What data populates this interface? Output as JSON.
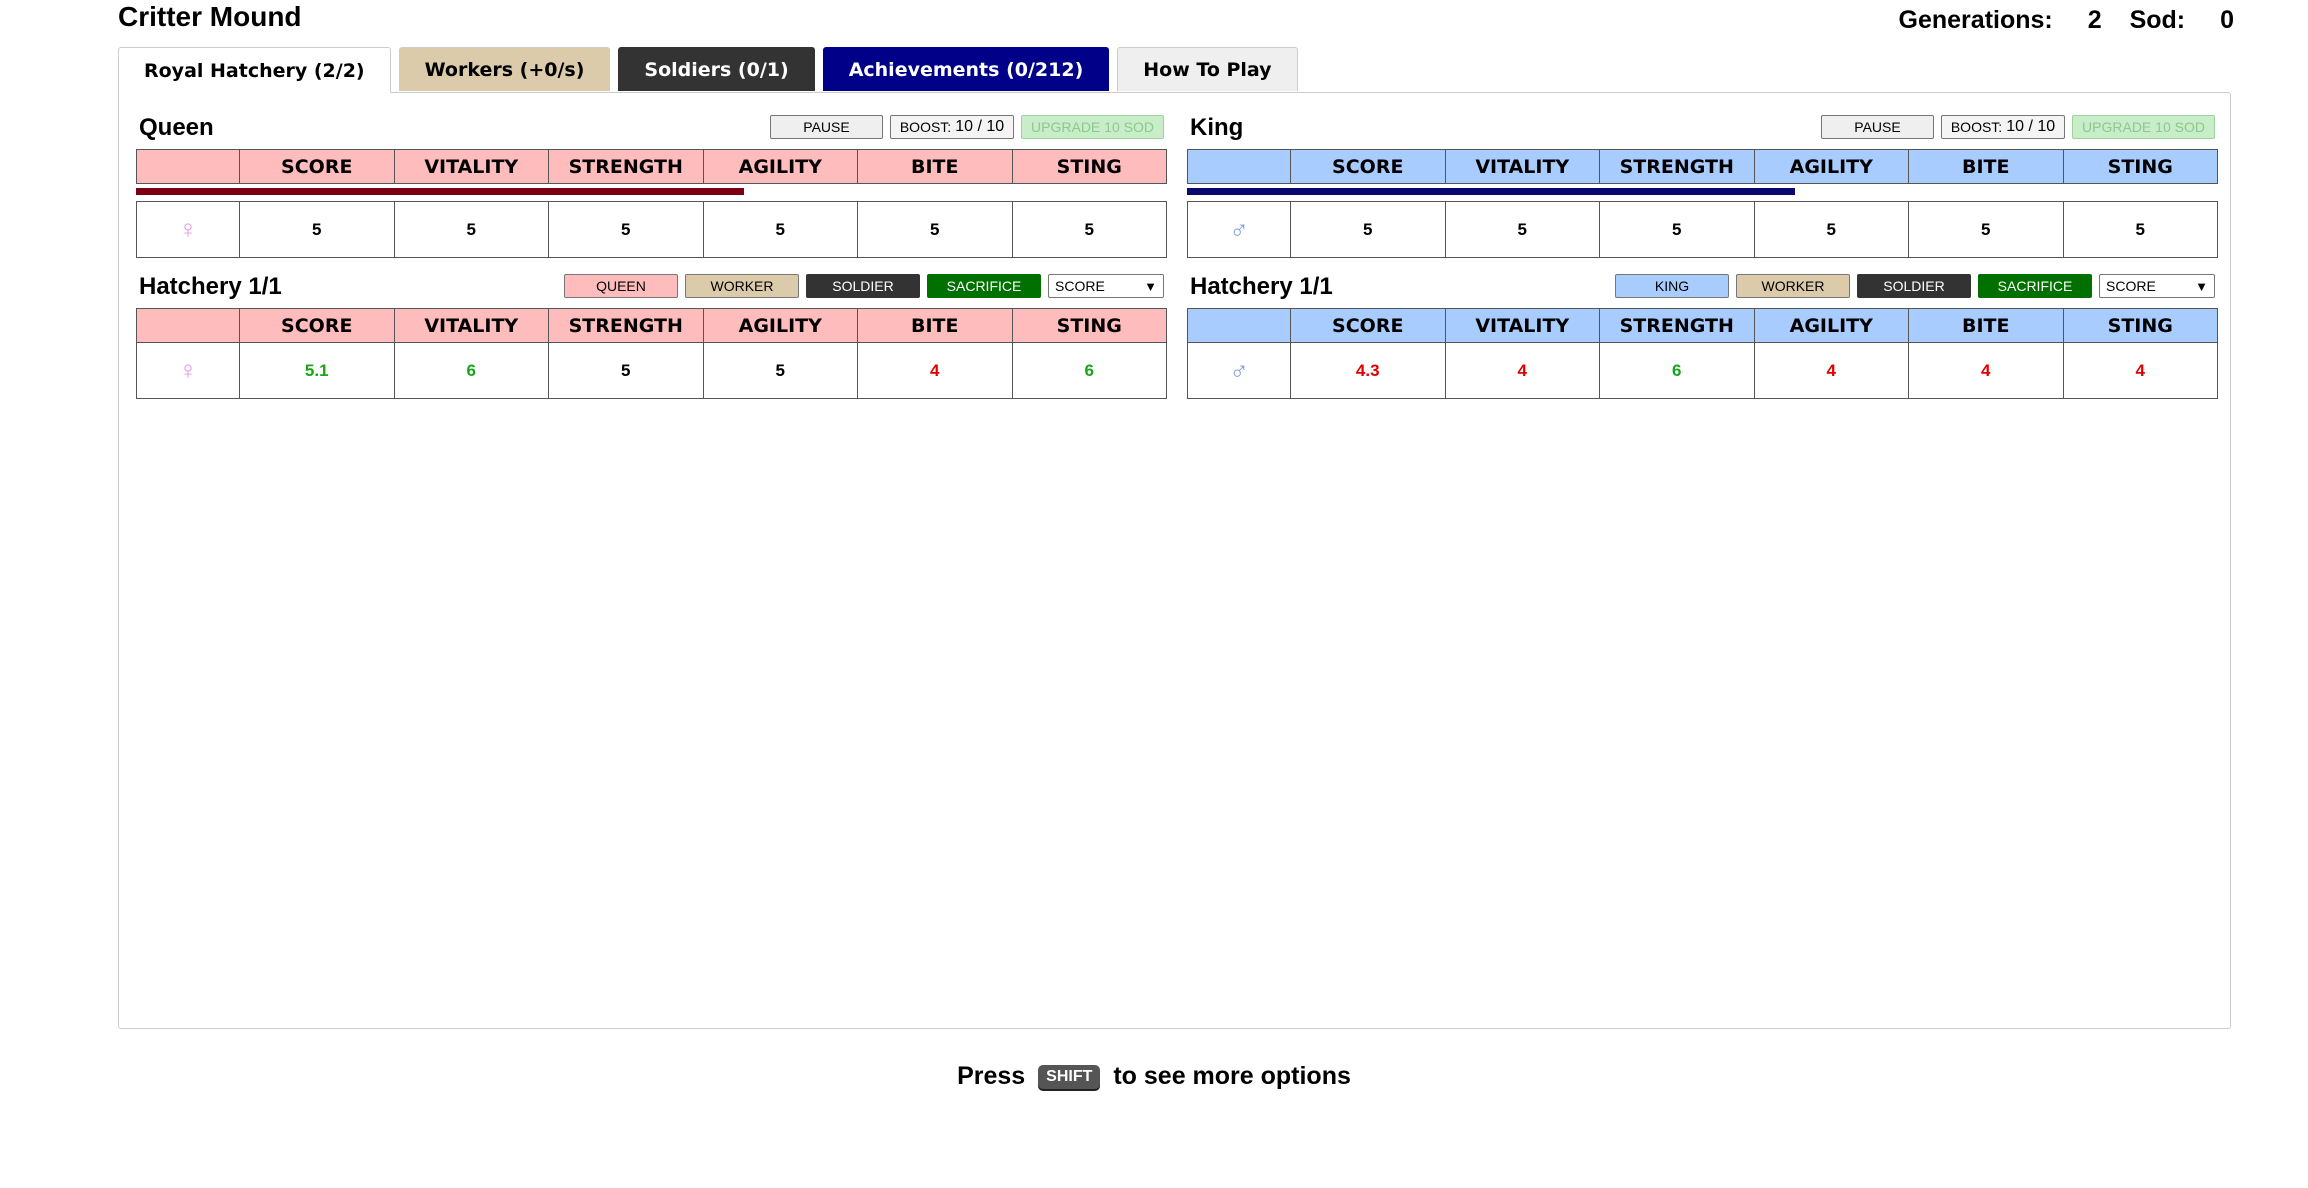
{
  "app_title": "Critter Mound",
  "header": {
    "generations_label": "Generations:",
    "generations": "2",
    "sod_label": "Sod:",
    "sod": "0"
  },
  "tabs": [
    {
      "label": "Royal Hatchery (2/2)"
    },
    {
      "label": "Workers (+0/s)"
    },
    {
      "label": "Soldiers (0/1)"
    },
    {
      "label": "Achievements (0/212)"
    },
    {
      "label": "How To Play"
    }
  ],
  "columns": [
    "SCORE",
    "VITALITY",
    "STRENGTH",
    "AGILITY",
    "BITE",
    "STING"
  ],
  "queen": {
    "title": "Queen",
    "pause_label": "PAUSE",
    "boost_label": "BOOST:",
    "boost_value": "10 / 10",
    "upgrade_label": "UPGRADE 10 SOD",
    "progress": 0.59,
    "progress_color": "#7a0012",
    "symbol_icon": "female-symbol-icon",
    "stats": [
      "5",
      "5",
      "5",
      "5",
      "5",
      "5"
    ]
  },
  "king": {
    "title": "King",
    "pause_label": "PAUSE",
    "boost_label": "BOOST:",
    "boost_value": "10 / 10",
    "upgrade_label": "UPGRADE 10 SOD",
    "progress": 0.59,
    "progress_color": "#0a0a6e",
    "symbol_icon": "male-symbol-icon",
    "stats": [
      "5",
      "5",
      "5",
      "5",
      "5",
      "5"
    ]
  },
  "hatchery_female": {
    "title": "Hatchery 1/1",
    "buttons": [
      "QUEEN",
      "WORKER",
      "SOLDIER",
      "SACRIFICE"
    ],
    "sort_value": "SCORE",
    "stats": [
      {
        "value": "5.1",
        "trend": "up"
      },
      {
        "value": "6",
        "trend": "up"
      },
      {
        "value": "5",
        "trend": "same"
      },
      {
        "value": "5",
        "trend": "same"
      },
      {
        "value": "4",
        "trend": "down"
      },
      {
        "value": "6",
        "trend": "up"
      }
    ]
  },
  "hatchery_male": {
    "title": "Hatchery 1/1",
    "buttons": [
      "KING",
      "WORKER",
      "SOLDIER",
      "SACRIFICE"
    ],
    "sort_value": "SCORE",
    "stats": [
      {
        "value": "4.3",
        "trend": "down"
      },
      {
        "value": "4",
        "trend": "down"
      },
      {
        "value": "6",
        "trend": "up"
      },
      {
        "value": "4",
        "trend": "down"
      },
      {
        "value": "4",
        "trend": "down"
      },
      {
        "value": "4",
        "trend": "down"
      }
    ]
  },
  "footer": {
    "press": "Press",
    "key": "SHIFT",
    "rest": "to see more options"
  }
}
